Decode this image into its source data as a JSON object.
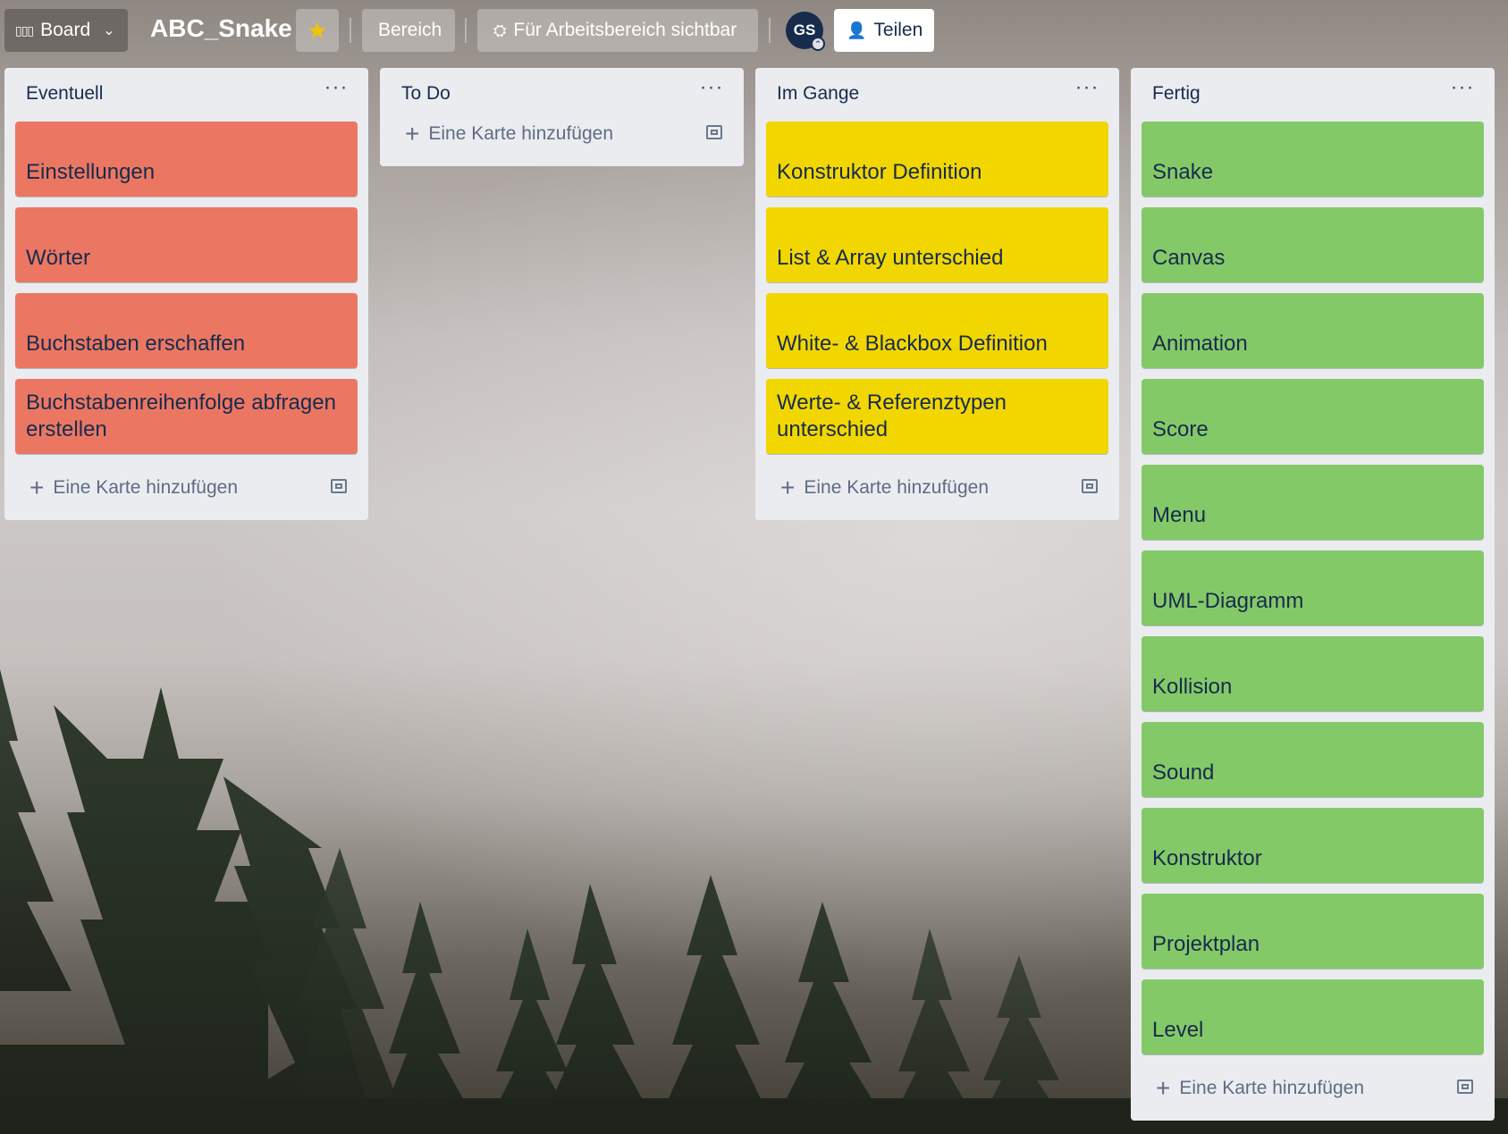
{
  "header": {
    "board_view_label": "Board",
    "board_title": "ABC_Snake",
    "star_icon": "star-icon",
    "workspace_label": "Bereich",
    "visibility_label": "Für Arbeitsbereich sichtbar",
    "member_initials": "GS",
    "share_label": "Teilen"
  },
  "colors": {
    "red_label": "#eb7763",
    "yellow_label": "#f2d600",
    "green_label": "#84c968",
    "list_bg": "#ebecf0",
    "text": "#172b4d"
  },
  "add_card_label": "Eine Karte hinzufügen",
  "lists": [
    {
      "title": "Eventuell",
      "color": "red",
      "cards": [
        "Einstellungen",
        "Wörter",
        "Buchstaben erschaffen",
        "Buchstabenreihenfolge abfragen erstellen"
      ]
    },
    {
      "title": "To Do",
      "color": "none",
      "cards": []
    },
    {
      "title": "Im Gange",
      "color": "yellow",
      "cards": [
        "Konstruktor Definition",
        "List & Array unterschied",
        "White- & Blackbox Definition",
        "Werte- & Referenztypen unterschied"
      ]
    },
    {
      "title": "Fertig",
      "color": "green",
      "cards": [
        "Snake",
        "Canvas",
        "Animation",
        "Score",
        "Menu",
        "UML-Diagramm",
        "Kollision",
        "Sound",
        "Konstruktor",
        "Projektplan",
        "Level"
      ]
    }
  ]
}
